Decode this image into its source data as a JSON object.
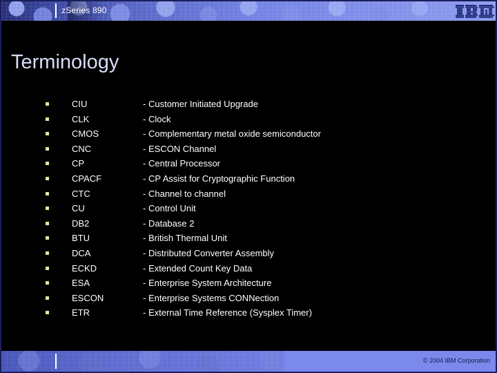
{
  "header": {
    "product_title": "zSeries 890",
    "logo_text": "IBM",
    "logo_name": "ibm-logo"
  },
  "title": "Terminology",
  "colors": {
    "background": "#000000",
    "header_band": "#6f7ee8",
    "footer_band": "#7b89ec",
    "title_text": "#d9dcf5",
    "body_text": "#ffffff",
    "bullet": "#dfe9a0",
    "logo": "#1f2a74"
  },
  "terms": [
    {
      "abbr": "CIU",
      "dash": "-",
      "definition": "Customer Initiated Upgrade"
    },
    {
      "abbr": "CLK",
      "dash": "-",
      "definition": "Clock"
    },
    {
      "abbr": "CMOS",
      "dash": "-",
      "definition": "Complementary metal oxide semiconductor"
    },
    {
      "abbr": "CNC",
      "dash": "-",
      "definition": "ESCON Channel"
    },
    {
      "abbr": "CP",
      "dash": "-",
      "definition": "Central Processor"
    },
    {
      "abbr": "CPACF",
      "dash": "-",
      "definition": "CP Assist for Cryptographic Function"
    },
    {
      "abbr": "CTC",
      "dash": "-",
      "definition": "Channel to channel"
    },
    {
      "abbr": "CU",
      "dash": "-",
      "definition": "Control Unit"
    },
    {
      "abbr": "DB2",
      "dash": "-",
      "definition": "Database 2"
    },
    {
      "abbr": "BTU",
      "dash": "-",
      "definition": "British Thermal Unit"
    },
    {
      "abbr": "DCA",
      "dash": "-",
      "definition": "Distributed Converter Assembly"
    },
    {
      "abbr": "ECKD",
      "dash": "-",
      "definition": "Extended Count Key Data"
    },
    {
      "abbr": "ESA",
      "dash": "-",
      "definition": "Enterprise System Architecture"
    },
    {
      "abbr": "ESCON",
      "dash": "-",
      "definition": "Enterprise Systems CONNection"
    },
    {
      "abbr": "ETR",
      "dash": "-",
      "definition": "External Time Reference (Sysplex Timer)"
    }
  ],
  "footer": {
    "copyright": "© 2004 IBM Corporation"
  }
}
